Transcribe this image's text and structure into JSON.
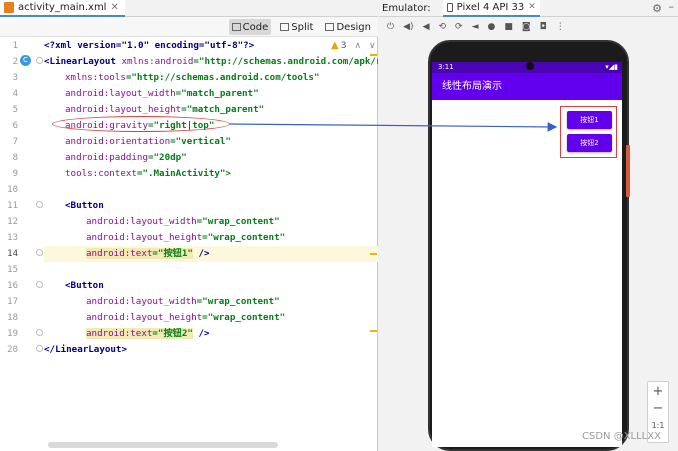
{
  "editor": {
    "file_tab": "activity_main.xml",
    "view_modes": {
      "code": "Code",
      "split": "Split",
      "design": "Design"
    },
    "warning_count": "3",
    "lines": [
      {
        "n": "1"
      },
      {
        "n": "2"
      },
      {
        "n": "3"
      },
      {
        "n": "4"
      },
      {
        "n": "5"
      },
      {
        "n": "6"
      },
      {
        "n": "7"
      },
      {
        "n": "8"
      },
      {
        "n": "9"
      },
      {
        "n": "10"
      },
      {
        "n": "11"
      },
      {
        "n": "12"
      },
      {
        "n": "13"
      },
      {
        "n": "14"
      },
      {
        "n": "15"
      },
      {
        "n": "16"
      },
      {
        "n": "17"
      },
      {
        "n": "18"
      },
      {
        "n": "19"
      },
      {
        "n": "20"
      }
    ],
    "code": {
      "l1": "<?xml version=\"1.0\" encoding=\"utf-8\"?>",
      "l2_tag": "<LinearLayout ",
      "l2_attr": "xmlns:android",
      "l2_val": "=\"http://schemas.android.com/apk/res",
      "l3_attr": "xmlns:tools",
      "l3_val": "=\"http://schemas.android.com/tools\"",
      "l4_attr": "android:layout_width",
      "l4_val": "=\"match_parent\"",
      "l5_attr": "android:layout_height",
      "l5_val": "=\"match_parent\"",
      "l6_attr": "android:gravity",
      "l6_val": "=\"right|top\"",
      "l7_attr": "android:orientation",
      "l7_val": "=\"vertical\"",
      "l8_attr": "android:padding",
      "l8_val": "=\"20dp\"",
      "l9_attr": "tools:context",
      "l9_val": "=\".MainActivity\">",
      "l11_tag": "<Button",
      "l12_attr": "android:layout_width",
      "l12_val": "=\"wrap_content\"",
      "l13_attr": "android:layout_height",
      "l13_val": "=\"wrap_content\"",
      "l14_attr": "android:text",
      "l14_val": "=\"按钮1\"",
      "l14_end": " />",
      "l16_tag": "<Button",
      "l17_attr": "android:layout_width",
      "l17_val": "=\"wrap_content\"",
      "l18_attr": "android:layout_height",
      "l18_val": "=\"wrap_content\"",
      "l19_attr": "android:text",
      "l19_val": "=\"按钮2\"",
      "l19_end": " />",
      "l20_tag": "</LinearLayout>"
    }
  },
  "emulator": {
    "label": "Emulator:",
    "device_tab": "Pixel 4 API 33",
    "status_time": "3:11",
    "app_title": "线性布局演示",
    "button1": "按钮1",
    "button2": "按钮2",
    "zoom_in": "+",
    "zoom_out": "−",
    "zoom_ratio": "1:1"
  },
  "watermark": "CSDN @XLLLXX",
  "colors": {
    "accent": "#6200ee",
    "status": "#4a04b4",
    "annotation": "#e23c3c",
    "arrow": "#3a5fcd"
  }
}
